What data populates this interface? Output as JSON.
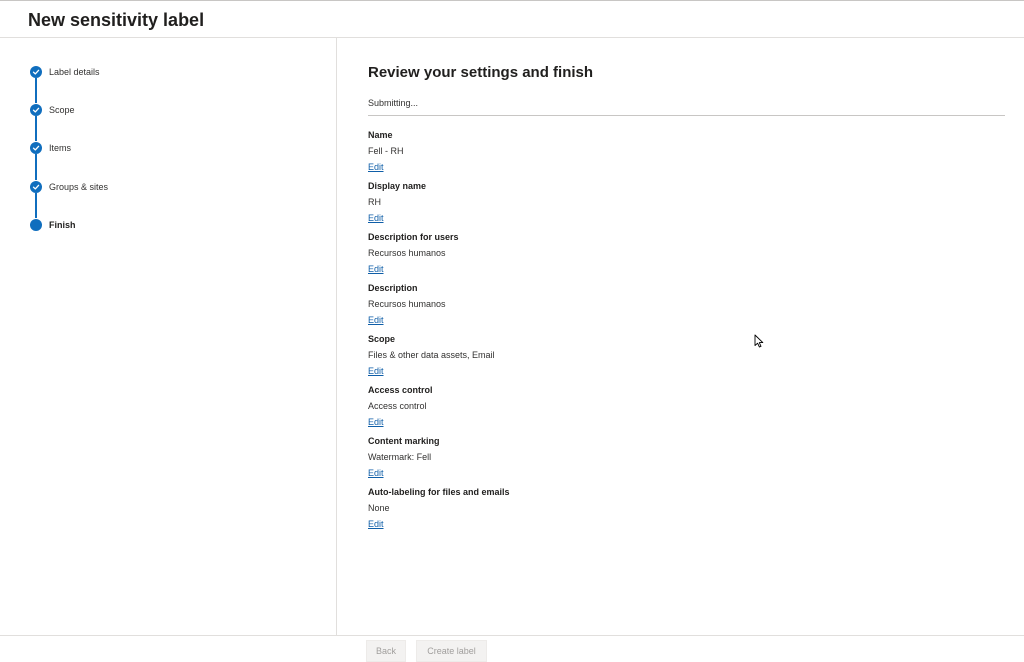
{
  "header": {
    "title": "New sensitivity label"
  },
  "wizard": {
    "steps": [
      {
        "label": "Label details",
        "state": "completed"
      },
      {
        "label": "Scope",
        "state": "completed"
      },
      {
        "label": "Items",
        "state": "completed"
      },
      {
        "label": "Groups & sites",
        "state": "completed"
      },
      {
        "label": "Finish",
        "state": "current"
      }
    ],
    "accent_color": "#106ebe"
  },
  "main": {
    "heading": "Review your settings and finish",
    "status": "Submitting...",
    "edit_label": "Edit",
    "sections": [
      {
        "title": "Name",
        "value": "Fell - RH"
      },
      {
        "title": "Display name",
        "value": "RH"
      },
      {
        "title": "Description for users",
        "value": "Recursos humanos"
      },
      {
        "title": "Description",
        "value": "Recursos humanos"
      },
      {
        "title": "Scope",
        "value": "Files & other data assets, Email"
      },
      {
        "title": "Access control",
        "value": "Access control"
      },
      {
        "title": "Content marking",
        "value": "Watermark: Fell"
      },
      {
        "title": "Auto-labeling for files and emails",
        "value": "None"
      }
    ]
  },
  "footer": {
    "back_label": "Back",
    "create_label": "Create label",
    "buttons_disabled": true
  },
  "icons": {
    "step_completed": "checkmark-circle-icon",
    "step_current": "filled-circle-icon",
    "pointer": "mouse-cursor-icon"
  }
}
